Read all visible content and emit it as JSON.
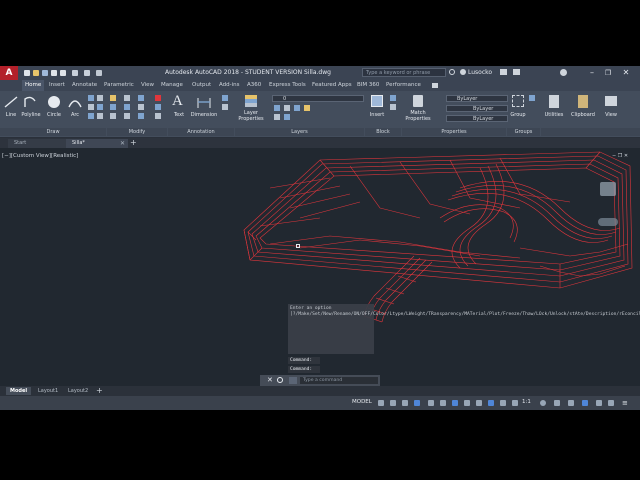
{
  "titlebar": {
    "title": "Autodesk AutoCAD 2018 - STUDENT VERSION    Silla.dwg",
    "search_placeholder": "Type a keyword or phrase",
    "user": "Lusocko",
    "min": "–",
    "max": "❐",
    "close": "✕"
  },
  "menu_tabs": [
    "Home",
    "Insert",
    "Annotate",
    "Parametric",
    "View",
    "Manage",
    "Output",
    "Add-ins",
    "A360",
    "Express Tools",
    "Featured Apps",
    "BIM 360",
    "Performance"
  ],
  "ribbon": {
    "draw_tools": [
      "Line",
      "Polyline",
      "Circle",
      "Arc"
    ],
    "text_label": "Text",
    "dimension_label": "Dimension",
    "layer_properties_label": "Layer Properties",
    "insert_label": "Insert",
    "match_properties_label": "Match Properties",
    "group_label": "Group",
    "utilities_label": "Utilities",
    "clipboard_label": "Clipboard",
    "view_label": "View",
    "layer_value": "0",
    "bylayer_color": "ByLayer",
    "bylayer_linetype": "ByLayer",
    "bylayer_lineweight": "ByLayer",
    "panels": [
      "Draw",
      "Modify",
      "Annotation",
      "Layers",
      "Block",
      "Properties",
      "Groups"
    ]
  },
  "file_tabs": {
    "start": "Start",
    "current": "Silla*",
    "add": "+"
  },
  "viewport": {
    "label": "[−][Custom View][Realistic]",
    "command_history": "Enter an option [?/Make/Set/New/Rename/ON/OFF/Color/Ltype/LWeight/TRansparency/MATerial/Plot/Freeze/Thaw/LOck/Unlock/stAte/Description/rEconcile]:",
    "command_line_1": "Command:",
    "command_line_2": "Command:",
    "command_placeholder": "Type a command"
  },
  "layout_tabs": [
    "Model",
    "Layout1",
    "Layout2"
  ],
  "status": {
    "model": "MODEL",
    "scale": "1:1"
  },
  "colors": {
    "wireframe": "#e0363c",
    "viewport_bg": "#212830",
    "ribbon_bg": "#434d5c"
  }
}
